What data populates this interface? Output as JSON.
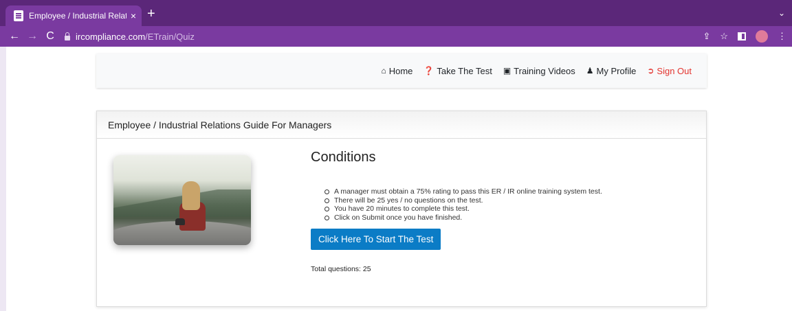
{
  "browser": {
    "tab_title": "Employee / Industrial Relations",
    "tab_close": "×",
    "new_tab": "+",
    "tab_menu": "⌄",
    "url_domain": "ircompliance.com",
    "url_path": "/ETrain/Quiz",
    "back": "←",
    "forward": "→",
    "reload": "C",
    "share_icon": "⇪",
    "star_icon": "☆",
    "menu_icon": "⋮"
  },
  "nav": {
    "home": "Home",
    "take_test": "Take The Test",
    "training_videos": "Training Videos",
    "my_profile": "My Profile",
    "sign_out": "Sign Out"
  },
  "card": {
    "header": "Employee / Industrial Relations Guide For Managers",
    "title": "Conditions",
    "conditions": [
      "A manager must obtain a 75% rating to pass this ER / IR online training system test.",
      "There will be 25 yes / no questions on the test.",
      "You have 20 minutes to complete this test.",
      "Click on Submit once you have finished."
    ],
    "start_button": "Click Here To Start The Test",
    "total_questions": "Total questions: 25"
  },
  "colors": {
    "chrome_dark": "#5b2779",
    "chrome": "#7a3aa0",
    "button": "#0b7cc6",
    "sign_out": "#e3342f"
  },
  "icons": {
    "home": "home-icon",
    "take_test": "question-circle-icon",
    "training_videos": "file-video-icon",
    "my_profile": "user-icon",
    "sign_out": "sign-out-icon"
  }
}
